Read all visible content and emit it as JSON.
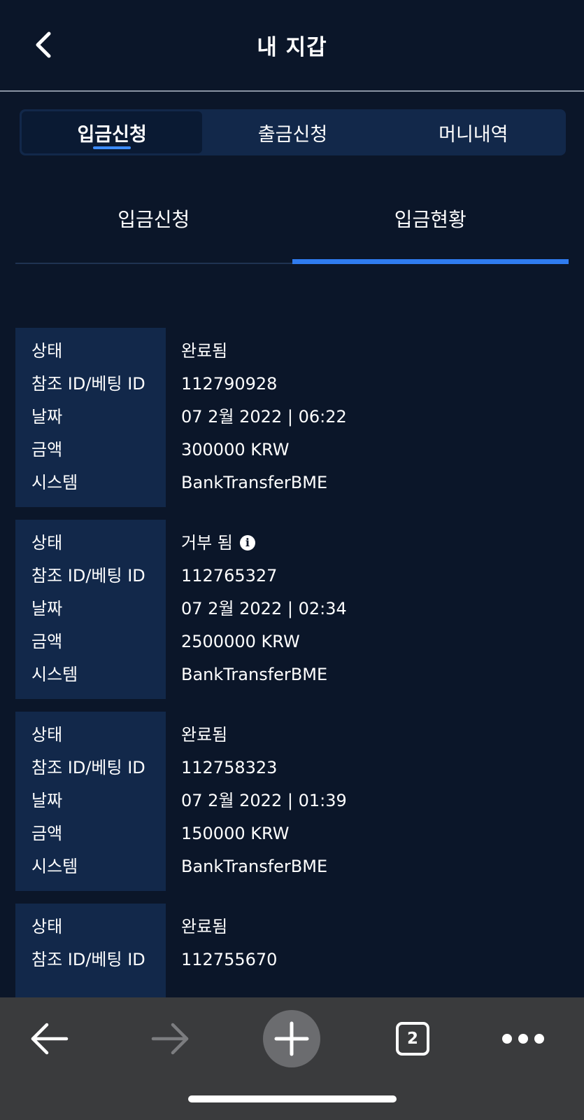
{
  "header": {
    "title": "내 지갑"
  },
  "main_tabs": [
    {
      "label": "입금신청"
    },
    {
      "label": "출금신청"
    },
    {
      "label": "머니내역"
    }
  ],
  "sub_tabs": [
    {
      "label": "입금신청"
    },
    {
      "label": "입금현황"
    }
  ],
  "labels": {
    "status": "상태",
    "ref_id": "참조 ID/베팅 ID",
    "date": "날짜",
    "amount": "금액",
    "system": "시스템"
  },
  "records": [
    {
      "status": "완료됨",
      "ref_id": "112790928",
      "date": "07 2월 2022 | 06:22",
      "amount": "300000 KRW",
      "system": "BankTransferBME"
    },
    {
      "status": "거부 됨",
      "ref_id": "112765327",
      "date": "07 2월 2022 | 02:34",
      "amount": "2500000 KRW",
      "system": "BankTransferBME"
    },
    {
      "status": "완료됨",
      "ref_id": "112758323",
      "date": "07 2월 2022 | 01:39",
      "amount": "150000 KRW",
      "system": "BankTransferBME"
    },
    {
      "status": "완료됨",
      "ref_id": "112755670"
    }
  ],
  "browser_bar": {
    "tab_count": "2"
  },
  "colors": {
    "background": "#0b1629",
    "panel": "#12284a",
    "accent": "#2f7cf0",
    "toolbar": "#3a3b3d"
  }
}
